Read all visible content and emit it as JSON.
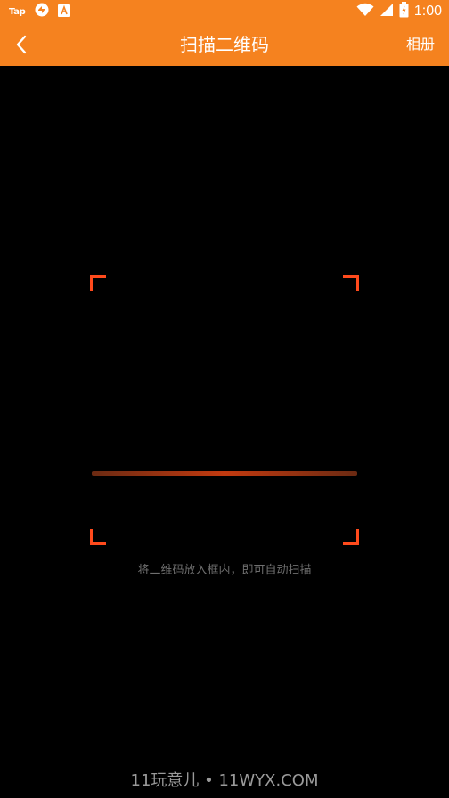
{
  "status_bar": {
    "left_icons": [
      "taptap-icon",
      "sync-icon",
      "app-store-icon"
    ],
    "tap_label": "Tap",
    "right_icons": [
      "wifi-icon",
      "signal-icon",
      "battery-icon"
    ],
    "time": "1:00"
  },
  "app_bar": {
    "back_icon": "chevron-left-icon",
    "title": "扫描二维码",
    "album_label": "相册",
    "color": "#f5821f"
  },
  "scanner": {
    "corner_color": "#ff4a1c",
    "hint": "将二维码放入框内，即可自动扫描"
  },
  "watermark": "11玩意儿 • 11WYX.COM"
}
